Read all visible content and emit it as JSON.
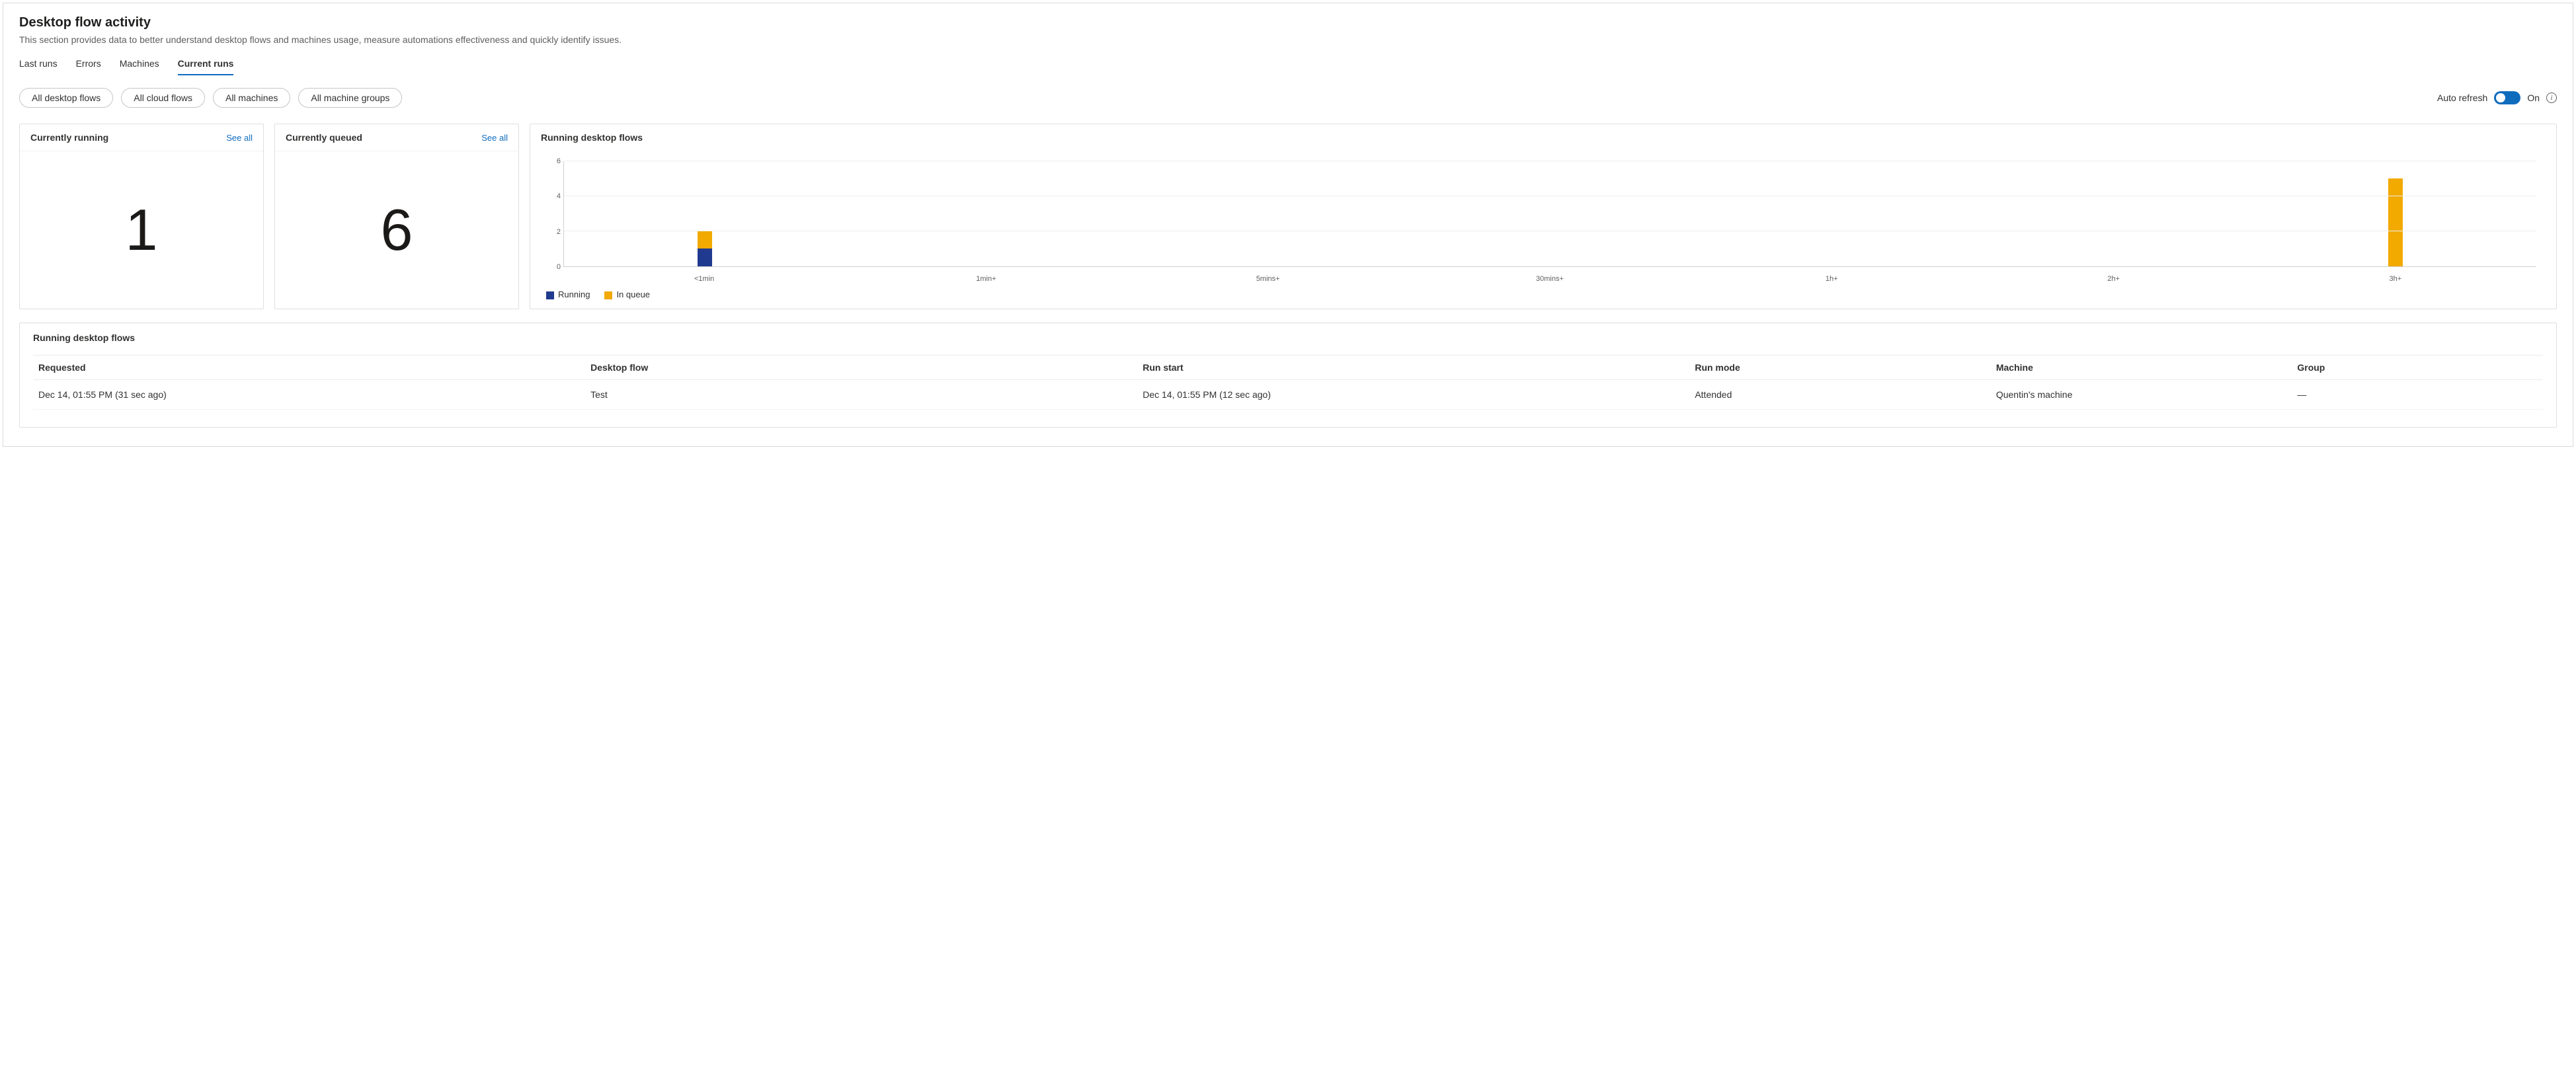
{
  "header": {
    "title": "Desktop flow activity",
    "subtitle": "This section provides data to better understand desktop flows and machines usage, measure automations effectiveness and quickly identify issues."
  },
  "tabs": [
    {
      "label": "Last runs",
      "active": false
    },
    {
      "label": "Errors",
      "active": false
    },
    {
      "label": "Machines",
      "active": false
    },
    {
      "label": "Current runs",
      "active": true
    }
  ],
  "filters": [
    "All desktop flows",
    "All cloud flows",
    "All machines",
    "All machine groups"
  ],
  "auto_refresh": {
    "label": "Auto refresh",
    "state_label": "On",
    "on": true
  },
  "cards": {
    "running": {
      "title": "Currently running",
      "see_all": "See all",
      "value": "1"
    },
    "queued": {
      "title": "Currently queued",
      "see_all": "See all",
      "value": "6"
    }
  },
  "chart_data": {
    "type": "bar",
    "title": "Running desktop flows",
    "categories": [
      "<1min",
      "1min+",
      "5mins+",
      "30mins+",
      "1h+",
      "2h+",
      "3h+"
    ],
    "series": [
      {
        "name": "Running",
        "color": "#203a8f",
        "values": [
          1,
          0,
          0,
          0,
          0,
          0,
          0
        ]
      },
      {
        "name": "In queue",
        "color": "#f2a900",
        "values": [
          1,
          0,
          0,
          0,
          0,
          0,
          5
        ]
      }
    ],
    "y_ticks": [
      0,
      2,
      4,
      6
    ],
    "ylim": [
      0,
      6
    ]
  },
  "table": {
    "title": "Running desktop flows",
    "columns": [
      "Requested",
      "Desktop flow",
      "Run start",
      "Run mode",
      "Machine",
      "Group"
    ],
    "rows": [
      {
        "requested": "Dec 14, 01:55 PM (31 sec ago)",
        "desktop_flow": "Test",
        "run_start": "Dec 14, 01:55 PM (12 sec ago)",
        "run_mode": "Attended",
        "machine": "Quentin's machine",
        "group": "—"
      }
    ]
  }
}
